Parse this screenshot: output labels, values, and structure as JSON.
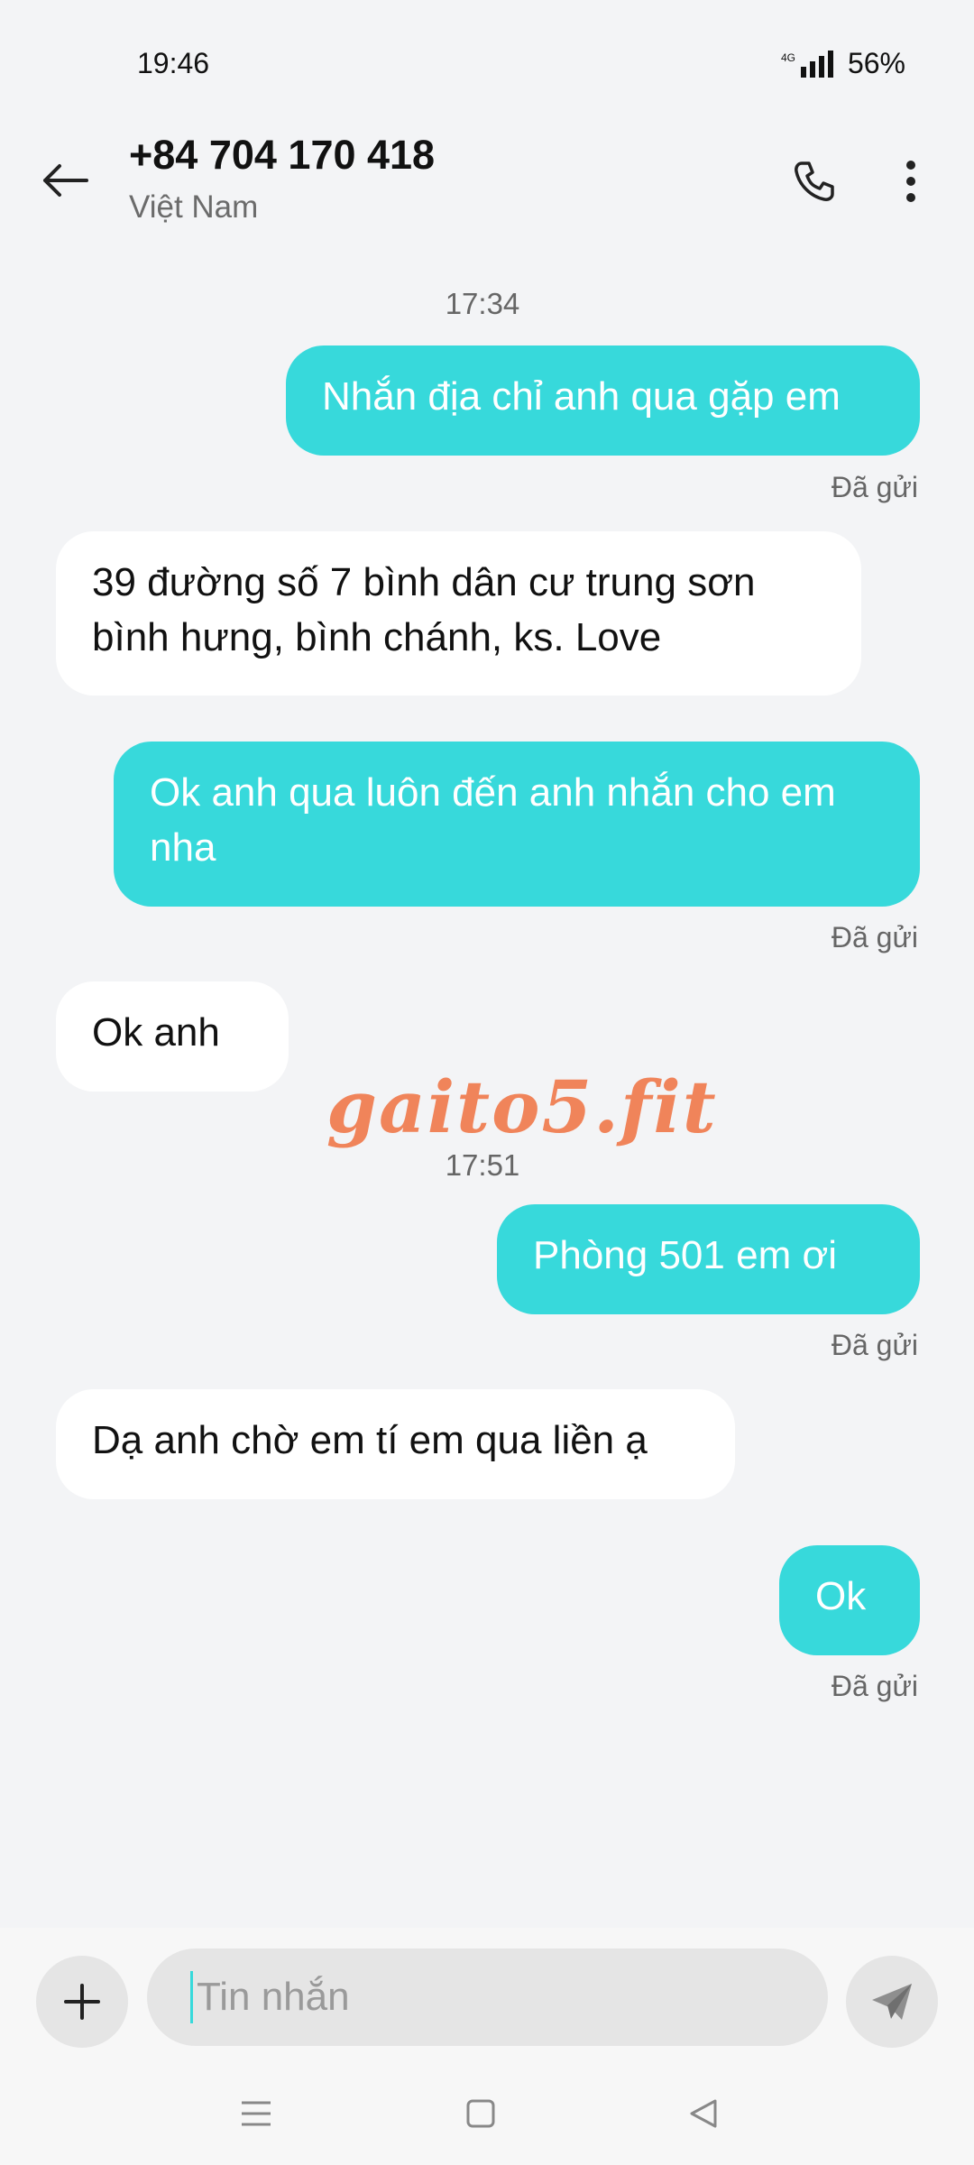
{
  "status_bar": {
    "time": "19:46",
    "network": "4G",
    "battery": "56%"
  },
  "header": {
    "contact_number": "+84 704 170 418",
    "contact_country": "Việt Nam"
  },
  "conversation": {
    "timestamps": [
      "17:34",
      "17:51"
    ],
    "messages": [
      {
        "direction": "sent",
        "text": "Nhắn địa chỉ anh qua gặp em",
        "status": "Đã gửi"
      },
      {
        "direction": "received",
        "text": "39 đường số 7 bình dân cư trung sơn bình hưng, bình chánh, ks. Love"
      },
      {
        "direction": "sent",
        "text": "Ok anh qua luôn đến anh nhắn cho em nha",
        "status": "Đã gửi"
      },
      {
        "direction": "received",
        "text": "Ok anh"
      },
      {
        "direction": "sent",
        "text": "Phòng 501 em ơi",
        "status": "Đã gửi"
      },
      {
        "direction": "received",
        "text": "Dạ anh chờ em tí em qua liền ạ"
      },
      {
        "direction": "sent",
        "text": "Ok",
        "status": "Đã gửi"
      }
    ]
  },
  "watermark": "gaito5.fit",
  "composer": {
    "placeholder": "Tin nhắn"
  },
  "icons": {
    "back": "arrow-left-icon",
    "call": "phone-icon",
    "more": "more-vertical-icon",
    "attach": "plus-icon",
    "send": "send-icon",
    "nav_menu": "menu-icon",
    "nav_home": "home-square-icon",
    "nav_back": "back-triangle-icon"
  },
  "colors": {
    "sent_bubble": "#37d9db",
    "received_bubble": "#ffffff",
    "background": "#f3f4f6",
    "watermark": "#f0845a"
  }
}
